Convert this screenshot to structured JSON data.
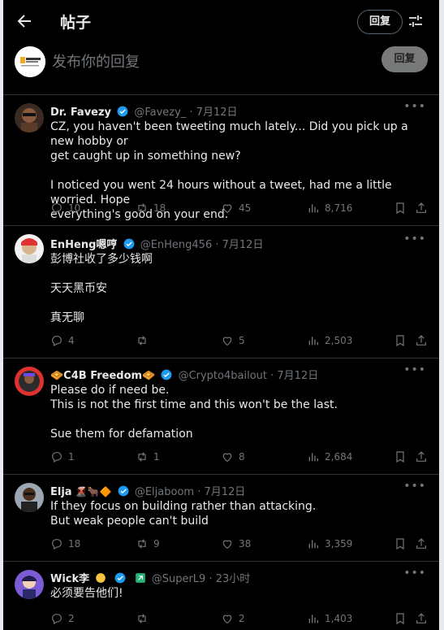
{
  "header": {
    "title": "帖子",
    "reply_label": "回复"
  },
  "composer": {
    "placeholder": "发布你的回复",
    "button": "回复"
  },
  "tweets": [
    {
      "name": "Dr. Favezy",
      "handle": "@Favezy_",
      "sep": "·",
      "time": "7月12日",
      "lines": [
        "CZ, you haven't been tweeting much lately... Did you pick up a new hobby or",
        "get caught up in something new?",
        "",
        "I noticed you went 24 hours without a tweet, had me a little worried. Hope",
        "everything's good on your end."
      ],
      "replies": "10",
      "retweets": "18",
      "likes": "45",
      "views": "8,716"
    },
    {
      "name": "EnHeng嗯哼",
      "handle": "@EnHeng456",
      "sep": "·",
      "time": "7月12日",
      "lines": [
        "彭博社收了多少钱啊",
        "",
        "天天黑币安",
        "",
        "真无聊"
      ],
      "replies": "4",
      "retweets": "",
      "likes": "5",
      "views": "2,503"
    },
    {
      "name": "🧇C4B Freedom🧇",
      "handle": "@Crypto4bailout",
      "sep": "·",
      "time": "7月12日",
      "lines": [
        "Please do if need be.",
        "This is not the first time and this won't be the last.",
        "",
        "Sue them for defamation"
      ],
      "replies": "1",
      "retweets": "1",
      "likes": "8",
      "views": "2,684"
    },
    {
      "name": "Elja",
      "name_emoji": "🌋🐂🔶",
      "handle": "@Eljaboom",
      "sep": "·",
      "time": "7月12日",
      "lines": [
        "If they focus on building rather than attacking.",
        "But weak people can't build"
      ],
      "replies": "18",
      "retweets": "9",
      "likes": "38",
      "views": "3,359"
    },
    {
      "name": "Wick李",
      "handle": "@SuperL9",
      "sep": "·",
      "time": "23小时",
      "lines": [
        "必须要告他们!"
      ],
      "replies": "2",
      "retweets": "",
      "likes": "2",
      "views": "1,403"
    }
  ]
}
